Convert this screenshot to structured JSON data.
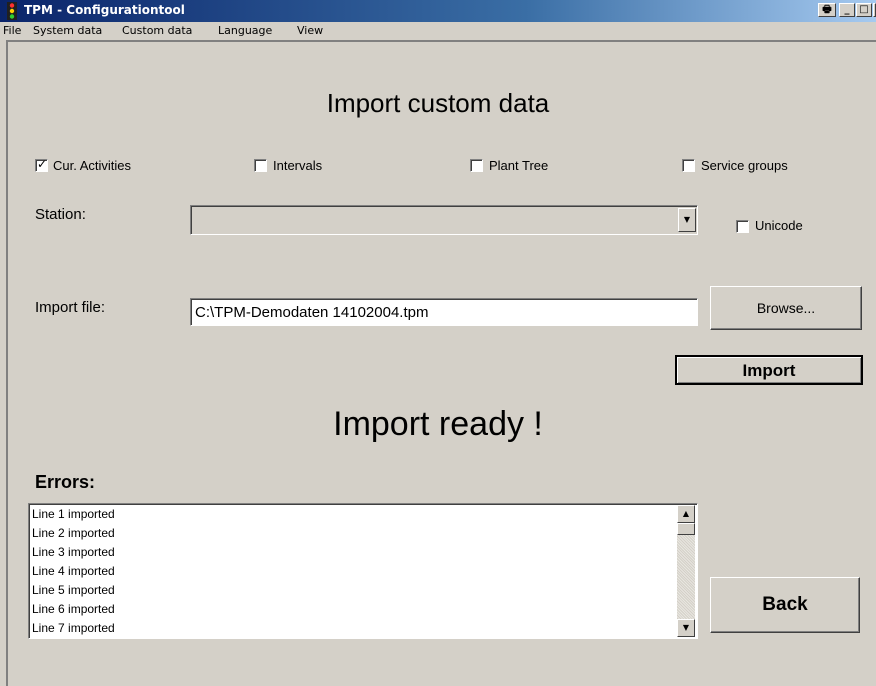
{
  "window": {
    "title": "TPM - Configurationtool",
    "controls": {
      "print": "🖶",
      "minimize": "_",
      "maximize": "□",
      "close": "×"
    }
  },
  "menu": [
    "File",
    "System data",
    "Custom data",
    "Language",
    "View"
  ],
  "page": {
    "heading": "Import custom data",
    "status": "Import ready !"
  },
  "checkboxes": {
    "activities": {
      "label": "Cur. Activities",
      "checked": true
    },
    "intervals": {
      "label": "Intervals",
      "checked": false
    },
    "plant_tree": {
      "label": "Plant Tree",
      "checked": false
    },
    "service_groups": {
      "label": "Service groups",
      "checked": false
    },
    "unicode": {
      "label": "Unicode",
      "checked": false
    }
  },
  "station": {
    "label": "Station:",
    "value": ""
  },
  "import_file": {
    "label": "Import file:",
    "value": "C:\\TPM-Demodaten 14102004.tpm"
  },
  "buttons": {
    "browse": "Browse...",
    "import": "Import",
    "back": "Back"
  },
  "errors": {
    "label": "Errors:",
    "lines": [
      "Line 1 imported",
      "Line 2 imported",
      "Line 3 imported",
      "Line 4 imported",
      "Line 5 imported",
      "Line 6 imported",
      "Line 7 imported"
    ]
  }
}
